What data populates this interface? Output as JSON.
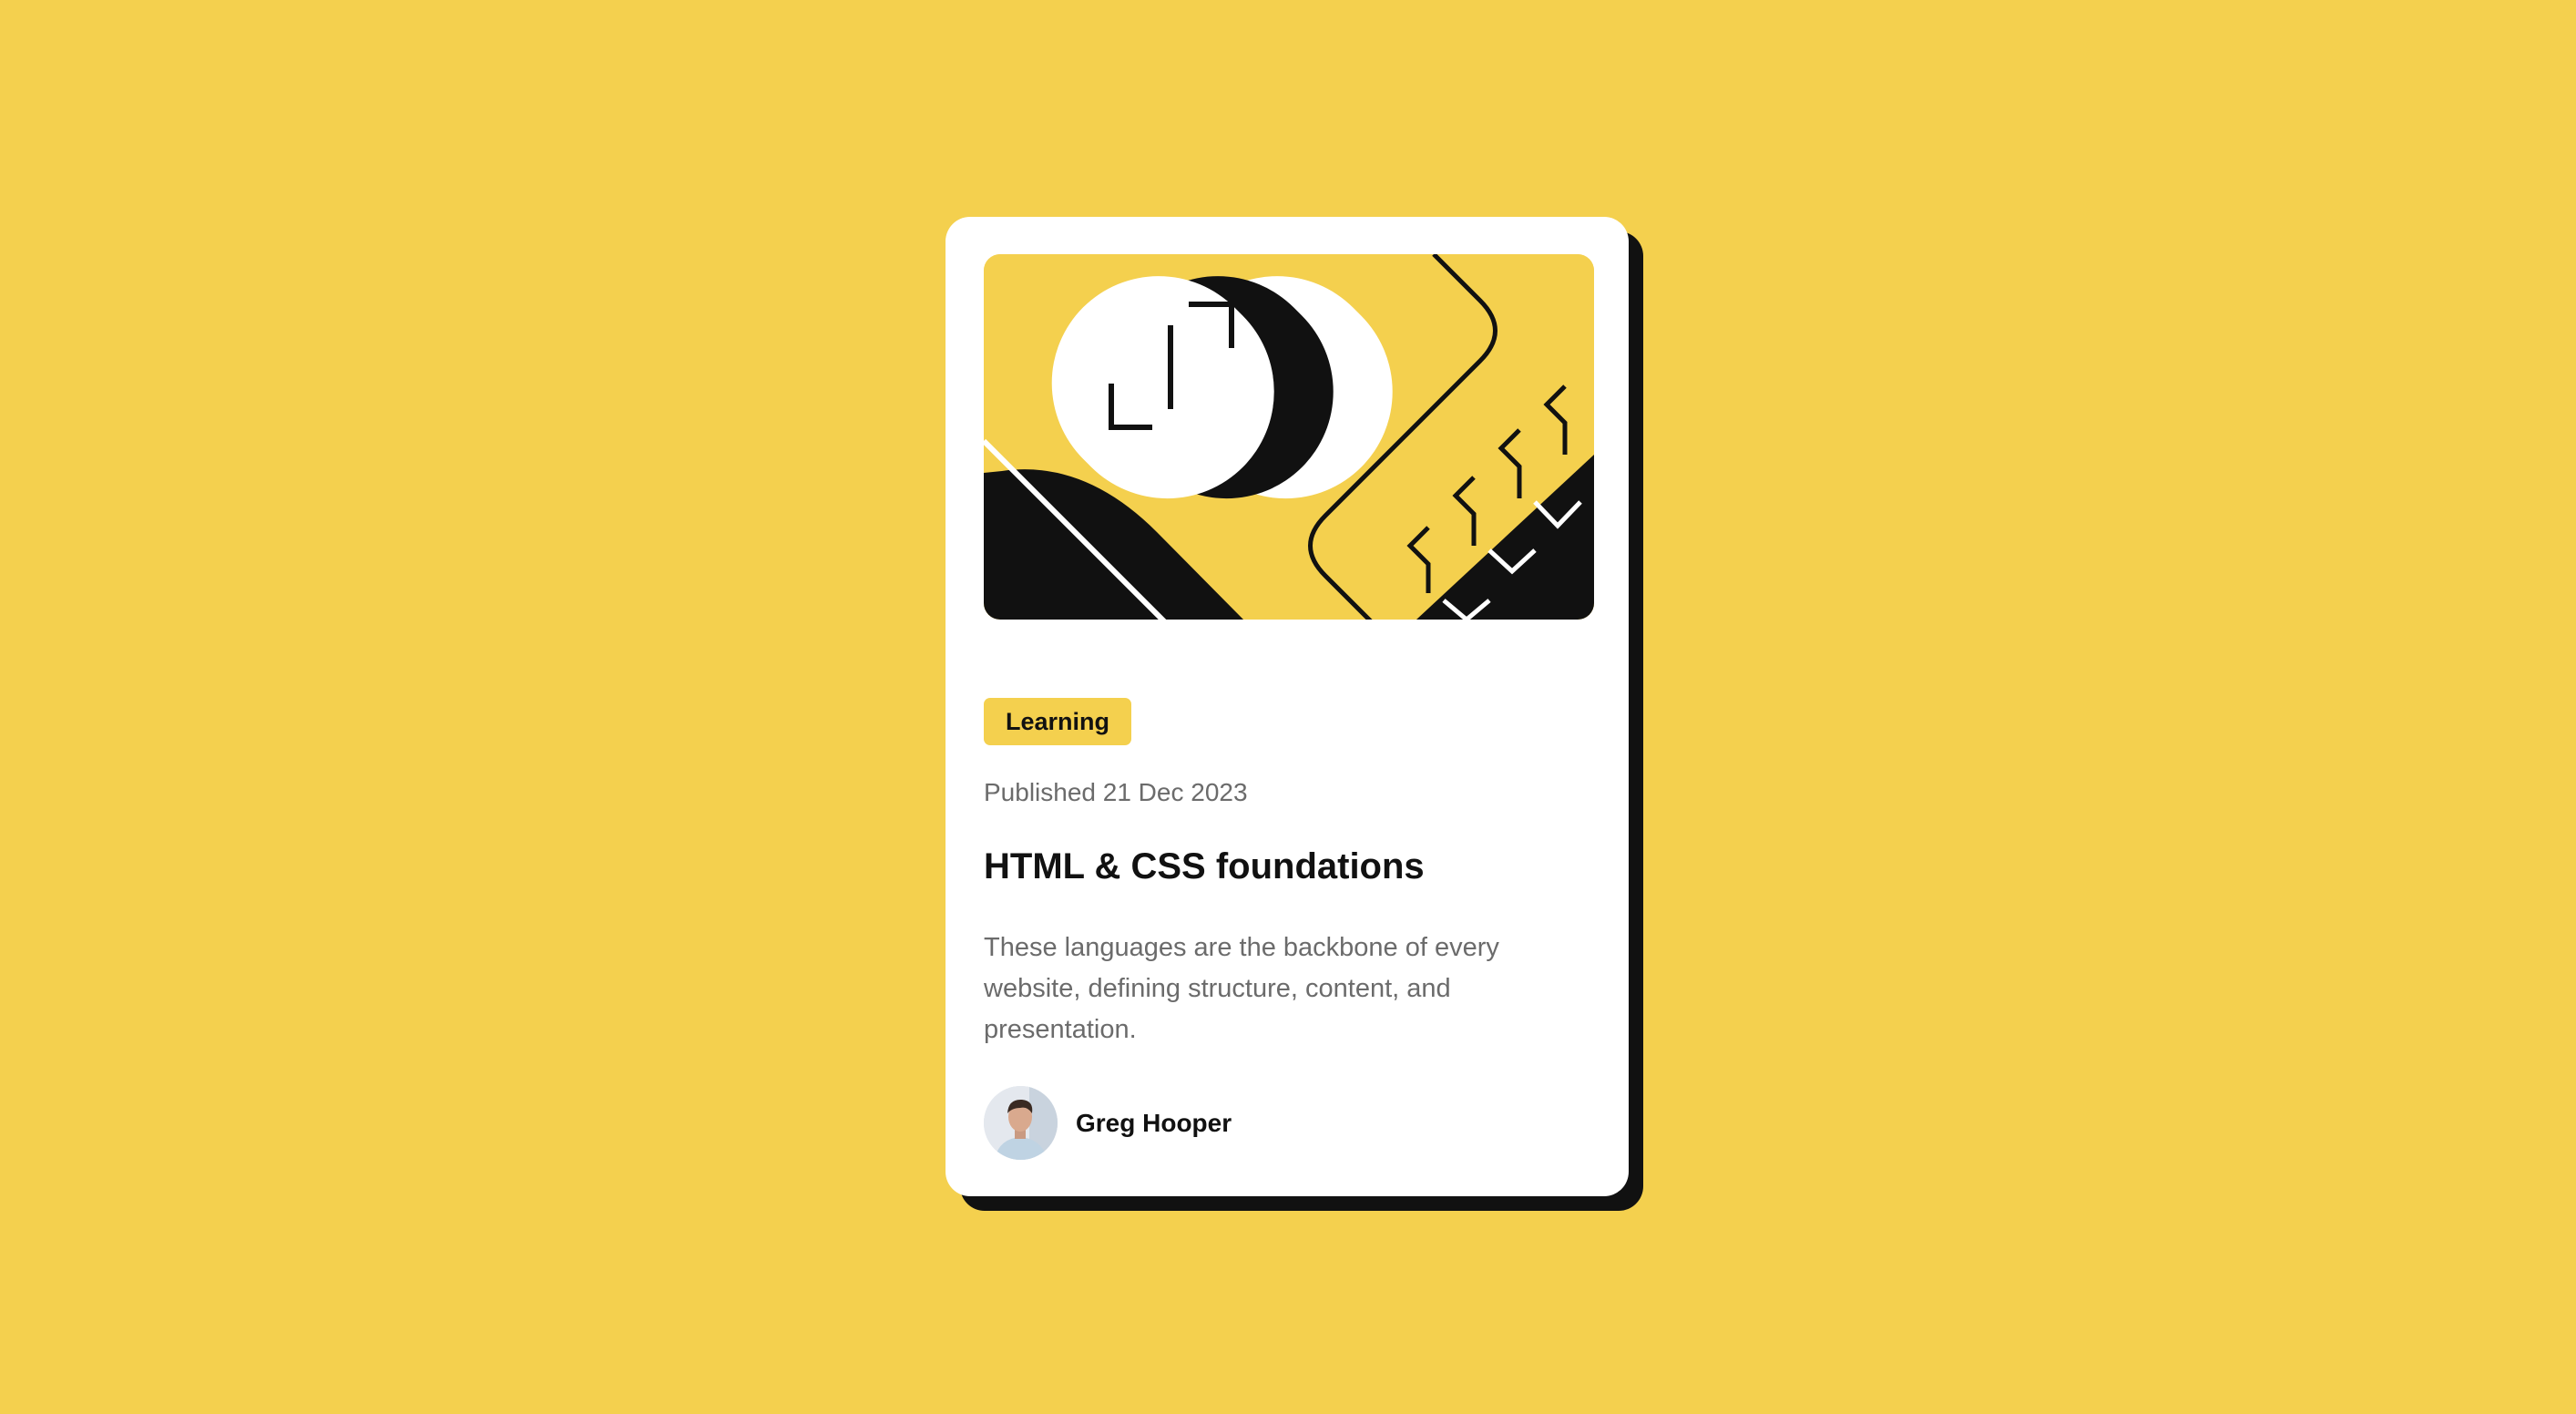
{
  "card": {
    "tag": "Learning",
    "published": "Published 21 Dec 2023",
    "title": "HTML & CSS foundations",
    "description": "These languages are the backbone of every website, defining structure, content, and presentation.",
    "author": {
      "name": "Greg Hooper"
    }
  },
  "colors": {
    "background": "#F4D04E",
    "card": "#FFFFFF",
    "shadow": "#111111",
    "text_primary": "#111111",
    "text_secondary": "#6B6B6B"
  },
  "icons": {
    "hero": "code-illustration",
    "avatar": "author-avatar"
  }
}
